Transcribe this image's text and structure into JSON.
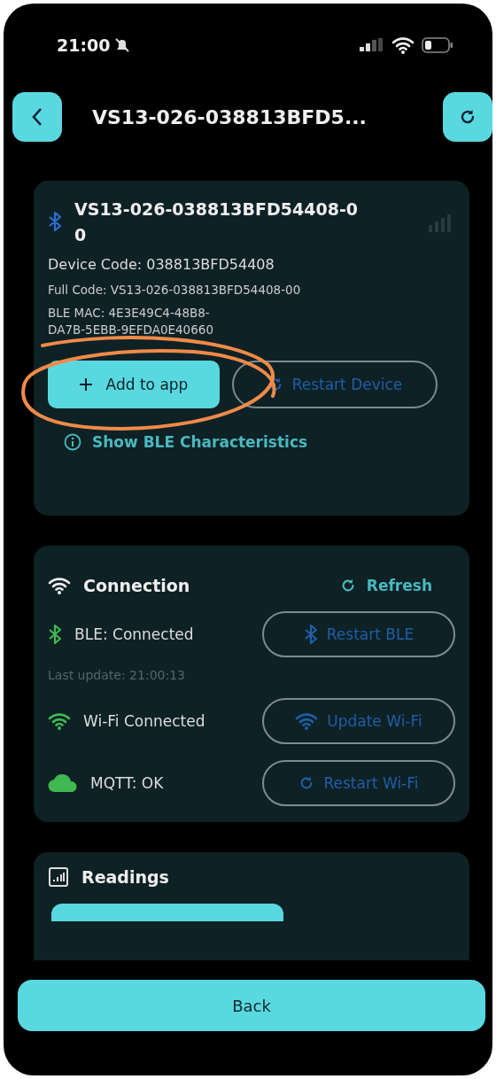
{
  "status_bar": {
    "time": "21:00",
    "silent": true
  },
  "header": {
    "title": "VS13-026-038813BFD5..."
  },
  "device": {
    "name": "VS13-026-038813BFD54408-0\n0",
    "device_code": "Device Code: 038813BFD54408",
    "full_code": "Full Code: VS13-026-038813BFD54408-00",
    "ble_mac": "BLE MAC: 4E3E49C4-48B8-\nDA7B-5EBB-9EFDA0E40660",
    "buttons": [
      {
        "label": "Add to app",
        "kind": "primary"
      },
      {
        "label": "Restart Device",
        "kind": "outline"
      }
    ],
    "link": "Show BLE Characteristics"
  },
  "connection": {
    "title": "Connection",
    "refresh": "Refresh",
    "last_update": "Last update: 21:00:13",
    "rows": [
      {
        "kind": "ble",
        "label": "BLE: Connected",
        "button": "Restart BLE"
      },
      {
        "kind": "wifi",
        "label": "Wi-Fi Connected",
        "button": "Update Wi-Fi"
      },
      {
        "kind": "mqtt",
        "label": "MQTT: OK",
        "button": "Restart Wi-Fi"
      }
    ]
  },
  "readings": {
    "title": "Readings"
  },
  "back_button": "Back"
}
